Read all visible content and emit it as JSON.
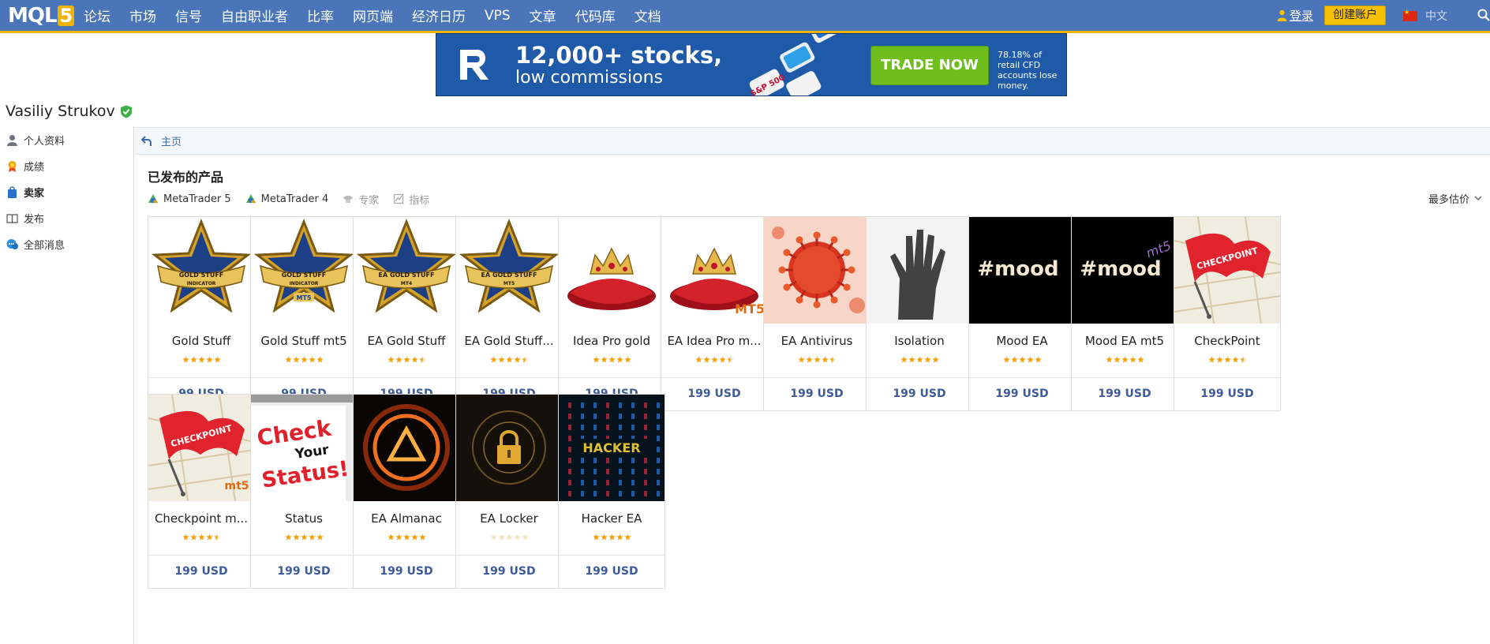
{
  "header": {
    "logo": "MQL5",
    "nav": [
      "论坛",
      "市场",
      "信号",
      "自由职业者",
      "比率",
      "网页端",
      "经济日历",
      "VPS",
      "文章",
      "代码库",
      "文档"
    ],
    "login": "登录",
    "create_account": "创建账户",
    "language": "中文"
  },
  "banner": {
    "headline": "12,000+ stocks,",
    "subline": "low commissions",
    "cta": "TRADE NOW",
    "disclaimer": "78.18% of retail CFD accounts lose money.",
    "tile_labels": [
      "S&P 500"
    ]
  },
  "profile": {
    "name": "Vasiliy Strukov"
  },
  "sidebar": {
    "items": [
      {
        "label": "个人资料",
        "icon": "user-icon",
        "active": false
      },
      {
        "label": "成绩",
        "icon": "medal-icon",
        "active": false
      },
      {
        "label": "卖家",
        "icon": "shopping-bag-icon",
        "active": true
      },
      {
        "label": "发布",
        "icon": "book-icon",
        "active": false
      },
      {
        "label": "全部消息",
        "icon": "chat-icon",
        "active": false
      }
    ]
  },
  "breadcrumb": {
    "home": "主页"
  },
  "section": {
    "title": "已发布的产品"
  },
  "filters": [
    {
      "label": "MetaTrader 5",
      "icon": "metatrader-icon",
      "enabled": true
    },
    {
      "label": "MetaTrader 4",
      "icon": "metatrader-icon",
      "enabled": true
    },
    {
      "label": "专家",
      "icon": "robot-icon",
      "enabled": false
    },
    {
      "label": "指标",
      "icon": "indicator-icon",
      "enabled": false
    }
  ],
  "sort": {
    "label": "最多估价"
  },
  "products": [
    {
      "name": "Gold Stuff",
      "price": "99 USD",
      "rating": 5,
      "image_text": [
        "GOLD STUFF",
        "INDICATOR"
      ],
      "image": "star-badge"
    },
    {
      "name": "Gold Stuff mt5",
      "price": "99 USD",
      "rating": 5,
      "image_text": [
        "GOLD STUFF",
        "INDICATOR",
        "MT5"
      ],
      "image": "star-badge"
    },
    {
      "name": "EA Gold Stuff",
      "price": "199 USD",
      "rating": 4.5,
      "image_text": [
        "EA GOLD STUFF",
        "MT4"
      ],
      "image": "star-badge"
    },
    {
      "name": "EA Gold Stuff...",
      "price": "199 USD",
      "rating": 4.5,
      "image_text": [
        "EA GOLD STUFF",
        "MT5"
      ],
      "image": "star-badge"
    },
    {
      "name": "Idea Pro gold",
      "price": "199 USD",
      "rating": 5,
      "image_text": [],
      "image": "crown"
    },
    {
      "name": "EA Idea Pro m...",
      "price": "199 USD",
      "rating": 4.5,
      "image_text": [
        "MT5"
      ],
      "image": "crown"
    },
    {
      "name": "EA Antivirus",
      "price": "199 USD",
      "rating": 4.5,
      "image_text": [],
      "image": "virus"
    },
    {
      "name": "Isolation",
      "price": "199 USD",
      "rating": 5,
      "image_text": [],
      "image": "hand"
    },
    {
      "name": "Mood EA",
      "price": "199 USD",
      "rating": 5,
      "image_text": [
        "#mood"
      ],
      "image": "mood"
    },
    {
      "name": "Mood EA mt5",
      "price": "199 USD",
      "rating": 5,
      "image_text": [
        "#mood",
        "mt5"
      ],
      "image": "mood"
    },
    {
      "name": "CheckPoint",
      "price": "199 USD",
      "rating": 4.5,
      "image_text": [
        "CHECKPOINT"
      ],
      "image": "flag"
    },
    {
      "name": "Checkpoint m...",
      "price": "199 USD",
      "rating": 4.5,
      "image_text": [
        "CHECKPOINT",
        "mt5"
      ],
      "image": "flag"
    },
    {
      "name": "Status",
      "price": "199 USD",
      "rating": 5,
      "image_text": [
        "Check",
        "Your",
        "Status!"
      ],
      "image": "status"
    },
    {
      "name": "EA Almanac",
      "price": "199 USD",
      "rating": 5,
      "image_text": [],
      "image": "almanac"
    },
    {
      "name": "EA Locker",
      "price": "199 USD",
      "rating": 0,
      "image_text": [],
      "image": "locker"
    },
    {
      "name": "Hacker EA",
      "price": "199 USD",
      "rating": 5,
      "image_text": [
        "HACKER"
      ],
      "image": "hacker"
    }
  ],
  "colors": {
    "topbar": "#4a76b9",
    "accent": "#f0b400",
    "link": "#3d6fb4",
    "price": "#3d5a9a",
    "star": "#f5a000",
    "trade_button": "#6fbe1e"
  }
}
